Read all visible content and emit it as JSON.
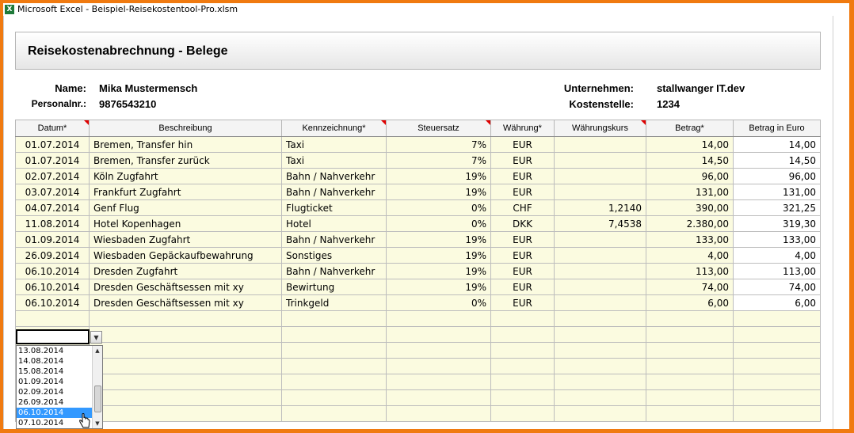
{
  "window": {
    "title": "Microsoft Excel - Beispiel-Reisekostentool-Pro.xlsm",
    "app_icon": "excel-icon"
  },
  "sheet": {
    "title": "Reisekostenabrechnung - Belege",
    "name_label": "Name:",
    "name_value": "Mika Mustermensch",
    "personalnr_label": "Personalnr.:",
    "personalnr_value": "9876543210",
    "company_label": "Unternehmen:",
    "company_value": "stallwanger IT.dev",
    "costcenter_label": "Kostenstelle:",
    "costcenter_value": "1234"
  },
  "table": {
    "headers": [
      "Datum*",
      "Beschreibung",
      "Kennzeichnung*",
      "Steuersatz",
      "Währung*",
      "Währungskurs",
      "Betrag*",
      "Betrag in Euro"
    ],
    "rows": [
      [
        "01.07.2014",
        "Bremen, Transfer hin",
        "Taxi",
        "7%",
        "EUR",
        "",
        "14,00",
        "14,00"
      ],
      [
        "01.07.2014",
        "Bremen, Transfer zurück",
        "Taxi",
        "7%",
        "EUR",
        "",
        "14,50",
        "14,50"
      ],
      [
        "02.07.2014",
        "Köln Zugfahrt",
        "Bahn / Nahverkehr",
        "19%",
        "EUR",
        "",
        "96,00",
        "96,00"
      ],
      [
        "03.07.2014",
        "Frankfurt Zugfahrt",
        "Bahn / Nahverkehr",
        "19%",
        "EUR",
        "",
        "131,00",
        "131,00"
      ],
      [
        "04.07.2014",
        "Genf Flug",
        "Flugticket",
        "0%",
        "CHF",
        "1,2140",
        "390,00",
        "321,25"
      ],
      [
        "11.08.2014",
        "Hotel Kopenhagen",
        "Hotel",
        "0%",
        "DKK",
        "7,4538",
        "2.380,00",
        "319,30"
      ],
      [
        "01.09.2014",
        "Wiesbaden Zugfahrt",
        "Bahn / Nahverkehr",
        "19%",
        "EUR",
        "",
        "133,00",
        "133,00"
      ],
      [
        "26.09.2014",
        "Wiesbaden Gepäckaufbewahrung",
        "Sonstiges",
        "19%",
        "EUR",
        "",
        "4,00",
        "4,00"
      ],
      [
        "06.10.2014",
        "Dresden Zugfahrt",
        "Bahn / Nahverkehr",
        "19%",
        "EUR",
        "",
        "113,00",
        "113,00"
      ],
      [
        "06.10.2014",
        "Dresden Geschäftsessen mit xy",
        "Bewirtung",
        "19%",
        "EUR",
        "",
        "74,00",
        "74,00"
      ],
      [
        "06.10.2014",
        "Dresden Geschäftsessen mit xy",
        "Trinkgeld",
        "0%",
        "EUR",
        "",
        "6,00",
        "6,00"
      ]
    ]
  },
  "dropdown": {
    "current_value": "",
    "options": [
      "13.08.2014",
      "14.08.2014",
      "15.08.2014",
      "01.09.2014",
      "02.09.2014",
      "26.09.2014",
      "06.10.2014",
      "07.10.2014"
    ],
    "selected": "06.10.2014"
  }
}
